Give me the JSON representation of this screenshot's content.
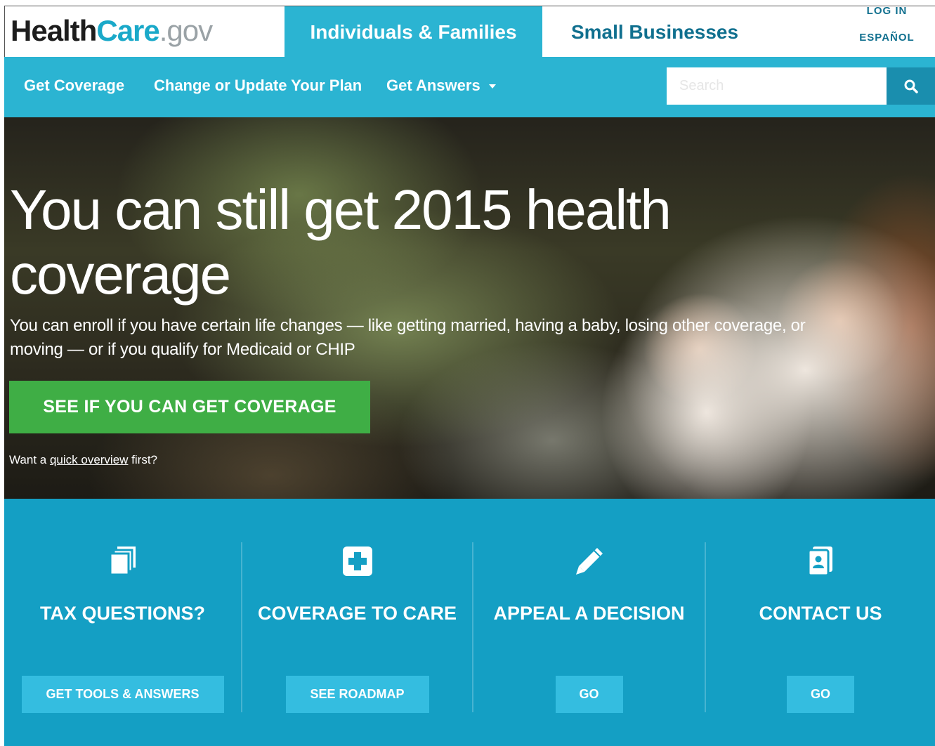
{
  "brand": {
    "logo_part1": "Health",
    "logo_part2": "Care",
    "logo_part3": ".gov",
    "colors": {
      "primary": "#2bb4d2",
      "dark_teal": "#11708f",
      "cta_green": "#3fae45",
      "card_bg": "#149fc4"
    }
  },
  "header": {
    "tab_individuals": "Individuals & Families",
    "tab_small_business": "Small Businesses",
    "login": "LOG IN",
    "espanol": "ESPAÑOL"
  },
  "nav": {
    "items": [
      {
        "label": "Get Coverage"
      },
      {
        "label": "Change or Update Your Plan"
      },
      {
        "label": "Get Answers"
      }
    ],
    "search_placeholder": "Search",
    "search_icon": "search-icon"
  },
  "hero": {
    "title": "You can still get 2015 health coverage",
    "subtitle": "You can enroll if you have certain life changes — like getting married, having a baby, losing other coverage, or moving — or if you qualify for Medicaid or CHIP",
    "cta": "SEE IF YOU CAN GET COVERAGE",
    "overview_prefix": "Want a ",
    "overview_link": "quick overview",
    "overview_suffix": " first?"
  },
  "cards": [
    {
      "icon": "copy-documents-icon",
      "title": "TAX QUESTIONS?",
      "button": "GET TOOLS & ANSWERS"
    },
    {
      "icon": "medical-cross-icon",
      "title": "COVERAGE TO CARE",
      "button": "SEE ROADMAP"
    },
    {
      "icon": "pencil-icon",
      "title": "APPEAL A DECISION",
      "button": "GO"
    },
    {
      "icon": "contact-card-icon",
      "title": "CONTACT US",
      "button": "GO"
    }
  ]
}
